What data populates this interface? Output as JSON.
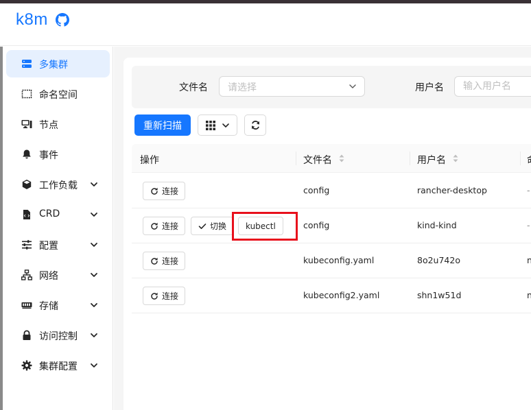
{
  "header": {
    "logo": "k8m"
  },
  "sidebar": {
    "items": [
      {
        "label": "多集群",
        "icon": "server-icon",
        "expandable": false,
        "active": true
      },
      {
        "label": "命名空间",
        "icon": "namespace-icon",
        "expandable": false
      },
      {
        "label": "节点",
        "icon": "desktop-icon",
        "expandable": false
      },
      {
        "label": "事件",
        "icon": "bell-icon",
        "expandable": false
      },
      {
        "label": "工作负载",
        "icon": "cube-icon",
        "expandable": true
      },
      {
        "label": "CRD",
        "icon": "file-code-icon",
        "expandable": true
      },
      {
        "label": "配置",
        "icon": "sliders-icon",
        "expandable": true
      },
      {
        "label": "网络",
        "icon": "network-icon",
        "expandable": true
      },
      {
        "label": "存储",
        "icon": "memory-icon",
        "expandable": true
      },
      {
        "label": "访问控制",
        "icon": "lock-icon",
        "expandable": true
      },
      {
        "label": "集群配置",
        "icon": "gear-icon",
        "expandable": true
      }
    ]
  },
  "filters": {
    "file_label": "文件名",
    "file_placeholder": "请选择",
    "user_label": "用户名",
    "user_placeholder": "输入用户名"
  },
  "toolbar": {
    "rescan_label": "重新扫描"
  },
  "table": {
    "headers": {
      "ops": "操作",
      "file": "文件名",
      "user": "用户名",
      "extra": "命"
    },
    "rows": [
      {
        "file": "config",
        "user": "rancher-desktop",
        "extra": "-",
        "actions": [
          "连接"
        ]
      },
      {
        "file": "config",
        "user": "kind-kind",
        "extra": "-",
        "actions": [
          "连接",
          "切换",
          "kubectl"
        ]
      },
      {
        "file": "kubeconfig.yaml",
        "user": "8o2u742o",
        "extra": "n",
        "actions": [
          "连接"
        ]
      },
      {
        "file": "kubeconfig2.yaml",
        "user": "shn1w51d",
        "extra": "n",
        "actions": [
          "连接"
        ]
      }
    ]
  },
  "colors": {
    "accent": "#1677ff",
    "highlight": "#e8101c"
  }
}
